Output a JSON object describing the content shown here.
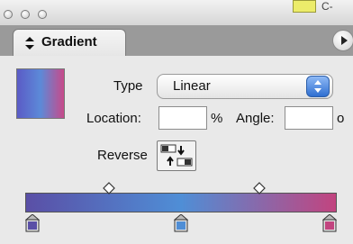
{
  "window": {
    "partial_tab_text": "C-"
  },
  "panel": {
    "tab_title": "Gradient"
  },
  "type_row": {
    "label": "Type",
    "selected": "Linear"
  },
  "location_row": {
    "label": "Location:",
    "value": "",
    "unit": "%"
  },
  "angle_row": {
    "label": "Angle:",
    "value": "",
    "unit": "o"
  },
  "reverse": {
    "label": "Reverse"
  },
  "icons": {
    "tab_arrows": "up-down-arrows-icon",
    "panel_menu": "panel-menu-arrow-icon",
    "reverse": "reverse-gradient-icon"
  },
  "gradient": {
    "preview_colors": [
      "#5b5bc6",
      "#5c8ad8",
      "#c84a8a"
    ],
    "stops": [
      {
        "location_pct": 0,
        "color": "#5a4fa6"
      },
      {
        "location_pct": 50,
        "color": "#4f8ed6"
      },
      {
        "location_pct": 100,
        "color": "#c2447f"
      }
    ],
    "midpoints_pct": [
      27,
      75
    ]
  },
  "colors": {
    "chrome": "#9a9a9a",
    "panel_bg": "#e9e9e9",
    "accent_select": "#2f6fd1"
  }
}
